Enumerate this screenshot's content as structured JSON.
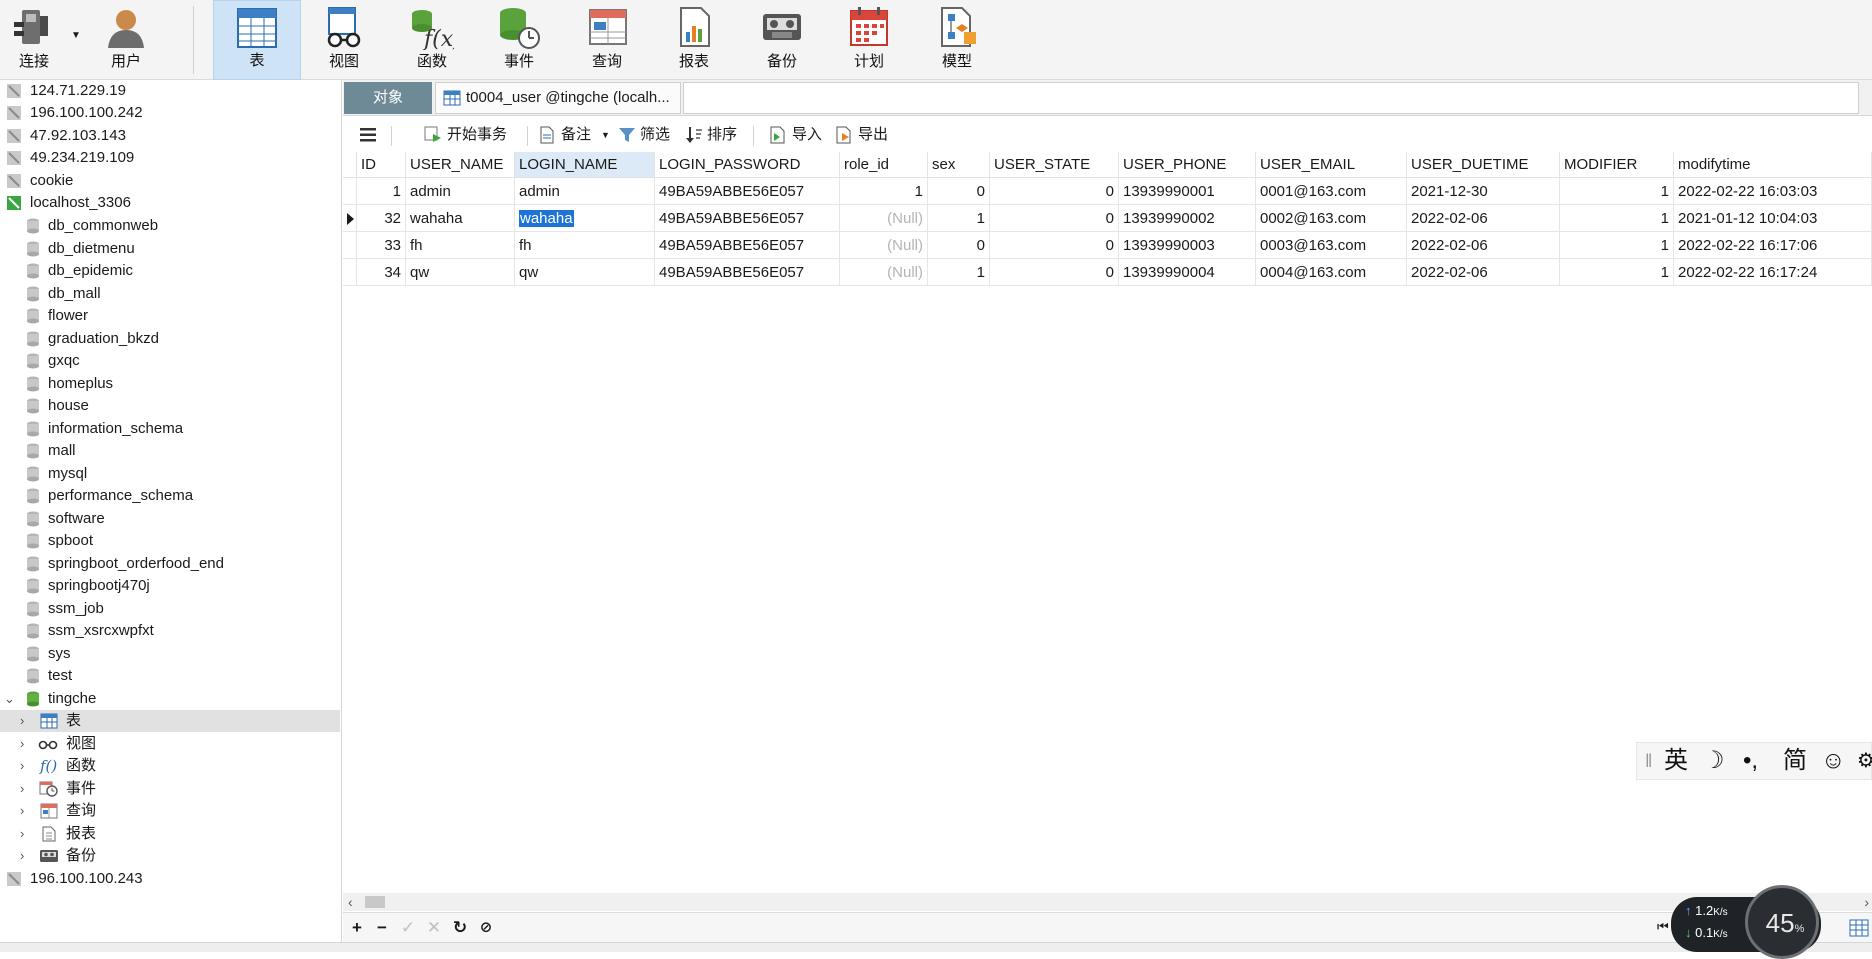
{
  "toolbar": {
    "items": [
      {
        "label": "连接",
        "icon": "plug-icon"
      },
      {
        "label": "用户",
        "icon": "user-icon"
      },
      {
        "label": "表",
        "icon": "table-icon",
        "active": true
      },
      {
        "label": "视图",
        "icon": "view-glasses-icon"
      },
      {
        "label": "函数",
        "icon": "function-icon"
      },
      {
        "label": "事件",
        "icon": "event-clock-icon"
      },
      {
        "label": "查询",
        "icon": "query-icon"
      },
      {
        "label": "报表",
        "icon": "report-icon"
      },
      {
        "label": "备份",
        "icon": "backup-icon"
      },
      {
        "label": "计划",
        "icon": "calendar-icon"
      },
      {
        "label": "模型",
        "icon": "model-icon"
      }
    ]
  },
  "sidebar": {
    "connections_top": [
      "124.71.229.19",
      "196.100.100.242",
      "47.92.103.143",
      "49.234.219.109",
      "cookie"
    ],
    "active_connection": "localhost_3306",
    "databases": [
      "db_commonweb",
      "db_dietmenu",
      "db_epidemic",
      "db_mall",
      "flower",
      "graduation_bkzd",
      "gxqc",
      "homeplus",
      "house",
      "information_schema",
      "mall",
      "mysql",
      "performance_schema",
      "software",
      "spboot",
      "springboot_orderfood_end",
      "springbootj470j",
      "ssm_job",
      "ssm_xsrcxwpfxt",
      "sys",
      "test"
    ],
    "open_database": "tingche",
    "children": [
      {
        "label": "表",
        "icon": "table-icon",
        "selected": true
      },
      {
        "label": "视图",
        "icon": "view-glasses-icon"
      },
      {
        "label": "函数",
        "icon": "function-icon"
      },
      {
        "label": "事件",
        "icon": "event-clock-icon"
      },
      {
        "label": "查询",
        "icon": "query-icon"
      },
      {
        "label": "报表",
        "icon": "report-icon"
      },
      {
        "label": "备份",
        "icon": "backup-icon"
      }
    ],
    "connections_bottom": [
      "196.100.100.243"
    ]
  },
  "tabs": {
    "objects_label": "对象",
    "file_tab_label": "t0004_user @tingche (localh..."
  },
  "data_toolbar": {
    "begin_transaction": "开始事务",
    "note": "备注",
    "filter": "筛选",
    "sort": "排序",
    "import": "导入",
    "export": "导出"
  },
  "grid": {
    "columns": [
      "ID",
      "USER_NAME",
      "LOGIN_NAME",
      "LOGIN_PASSWORD",
      "role_id",
      "sex",
      "USER_STATE",
      "USER_PHONE",
      "USER_EMAIL",
      "USER_DUETIME",
      "MODIFIER",
      "modifytime"
    ],
    "rows": [
      [
        "1",
        "admin",
        "admin",
        "49BA59ABBE56E057",
        "1",
        "0",
        "0",
        "13939990001",
        "0001@163.com",
        "2021-12-30",
        "1",
        "2022-02-22 16:03:03"
      ],
      [
        "32",
        "wahaha",
        "wahaha",
        "49BA59ABBE56E057",
        "(Null)",
        "1",
        "0",
        "13939990002",
        "0002@163.com",
        "2022-02-06",
        "1",
        "2021-01-12 10:04:03"
      ],
      [
        "33",
        "fh",
        "fh",
        "49BA59ABBE56E057",
        "(Null)",
        "0",
        "0",
        "13939990003",
        "0003@163.com",
        "2022-02-06",
        "1",
        "2022-02-22 16:17:06"
      ],
      [
        "34",
        "qw",
        "qw",
        "49BA59ABBE56E057",
        "(Null)",
        "1",
        "0",
        "13939990004",
        "0004@163.com",
        "2022-02-06",
        "1",
        "2022-02-22 16:17:24"
      ]
    ],
    "current_row": 1,
    "selected_column": "LOGIN_NAME"
  },
  "edit_toolbar": [
    "add-record",
    "delete-record",
    "apply",
    "discard",
    "refresh",
    "stop"
  ],
  "ime": {
    "items": [
      "英",
      "☽",
      "•,",
      "简",
      "☺"
    ]
  },
  "network": {
    "up": "1.2",
    "down": "0.1",
    "unit": "K/s",
    "percent": "45",
    "percent_unit": "%"
  }
}
